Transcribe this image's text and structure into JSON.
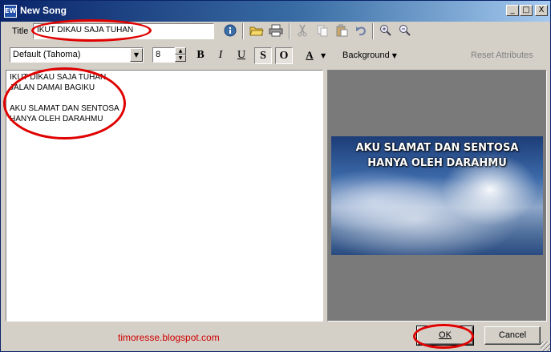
{
  "window": {
    "title": "New Song",
    "app_icon_text": "EW",
    "controls": {
      "minimize": "_",
      "maximize": "□",
      "close": "X"
    }
  },
  "header": {
    "title_label": "Title",
    "title_value": "IKUT DIKAU SAJA TUHAN"
  },
  "toolbar": {
    "icons": [
      "info-icon",
      "open-folder-icon",
      "print-icon",
      "cut-icon",
      "copy-icon",
      "paste-icon",
      "undo-icon",
      "zoom-in-icon",
      "zoom-out-icon"
    ]
  },
  "format_bar": {
    "font_select_value": "Default (Tahoma)",
    "font_size_value": "8",
    "bold": "B",
    "italic": "I",
    "underline": "U",
    "strike": "S",
    "outline": "O",
    "color": "A",
    "background_label": "Background",
    "reset_label": "Reset Attributes"
  },
  "editor": {
    "lines": [
      "IKUT DIKAU SAJA TUHAN",
      "JALAN DAMAI BAGIKU",
      "",
      "AKU SLAMAT DAN SENTOSA",
      "HANYA OLEH DARAHMU"
    ]
  },
  "preview": {
    "lines": [
      "AKU SLAMAT DAN SENTOSA",
      "HANYA OLEH DARAHMU"
    ]
  },
  "footer": {
    "watermark": "timoresse.blogspot.com",
    "ok_label": "OK",
    "cancel_label": "Cancel"
  },
  "colors": {
    "titlebar_start": "#0a246a",
    "annotation_red": "#e00000",
    "watermark_red": "#d00000",
    "preview_bg": "#7a7a7a"
  }
}
